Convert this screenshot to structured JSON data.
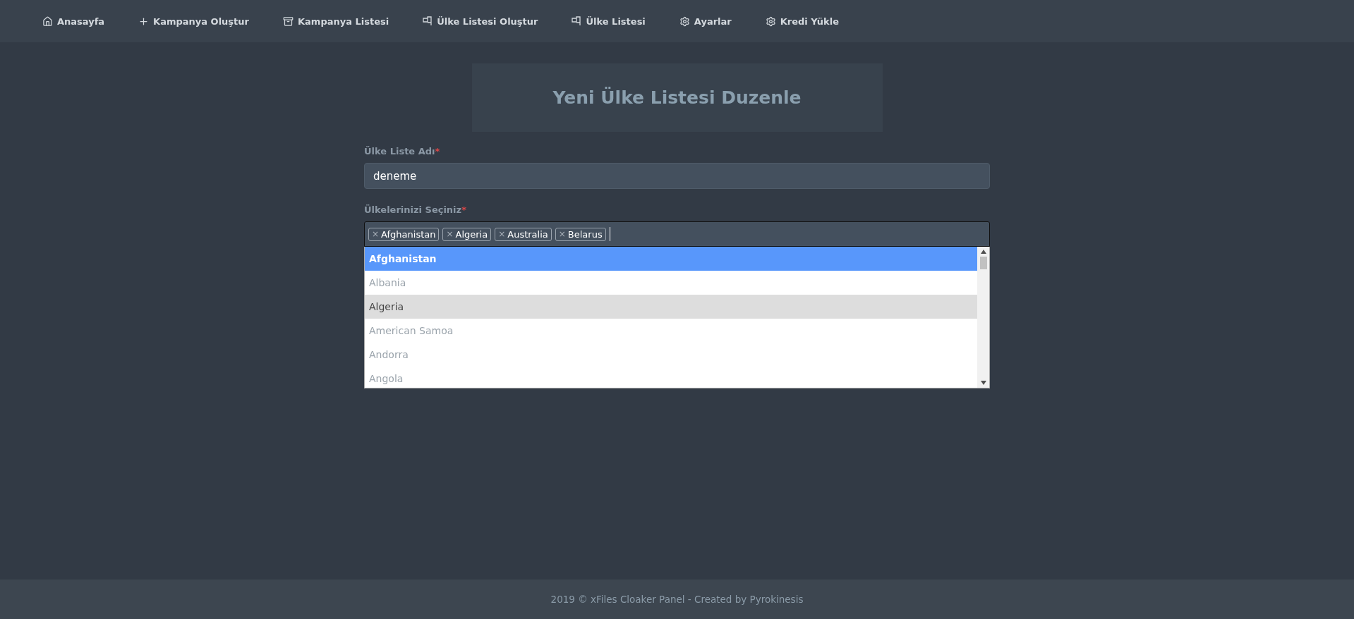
{
  "nav": [
    {
      "kind": "house",
      "label": "Anasayfa"
    },
    {
      "kind": "plus",
      "label": "Kampanya Oluştur"
    },
    {
      "kind": "archive",
      "label": "Kampanya Listesi"
    },
    {
      "kind": "flag",
      "label": "Ülke Listesi Oluştur"
    },
    {
      "kind": "flag",
      "label": "Ülke Listesi"
    },
    {
      "kind": "gear",
      "label": "Ayarlar"
    },
    {
      "kind": "gear",
      "label": "Kredi Yükle"
    }
  ],
  "page_title": "Yeni Ülke Listesi Duzenle",
  "name_field": {
    "label": "Ülke Liste Adı",
    "required_mark": "*",
    "value": "deneme"
  },
  "countries_field": {
    "label": "Ülkelerinizi Seçiniz",
    "required_mark": "*",
    "tags": [
      {
        "remove": "×",
        "label": "Afghanistan"
      },
      {
        "remove": "×",
        "label": "Algeria"
      },
      {
        "remove": "×",
        "label": "Australia"
      },
      {
        "remove": "×",
        "label": "Belarus"
      }
    ],
    "options": [
      {
        "label": "Afghanistan",
        "selected": true,
        "highlighted": true
      },
      {
        "label": "Albania",
        "selected": false,
        "highlighted": false
      },
      {
        "label": "Algeria",
        "selected": true,
        "highlighted": false
      },
      {
        "label": "American Samoa",
        "selected": false,
        "highlighted": false
      },
      {
        "label": "Andorra",
        "selected": false,
        "highlighted": false
      },
      {
        "label": "Angola",
        "selected": false,
        "highlighted": false
      }
    ]
  },
  "footer": "2019 © xFiles Cloaker Panel - Created by Pyrokinesis"
}
